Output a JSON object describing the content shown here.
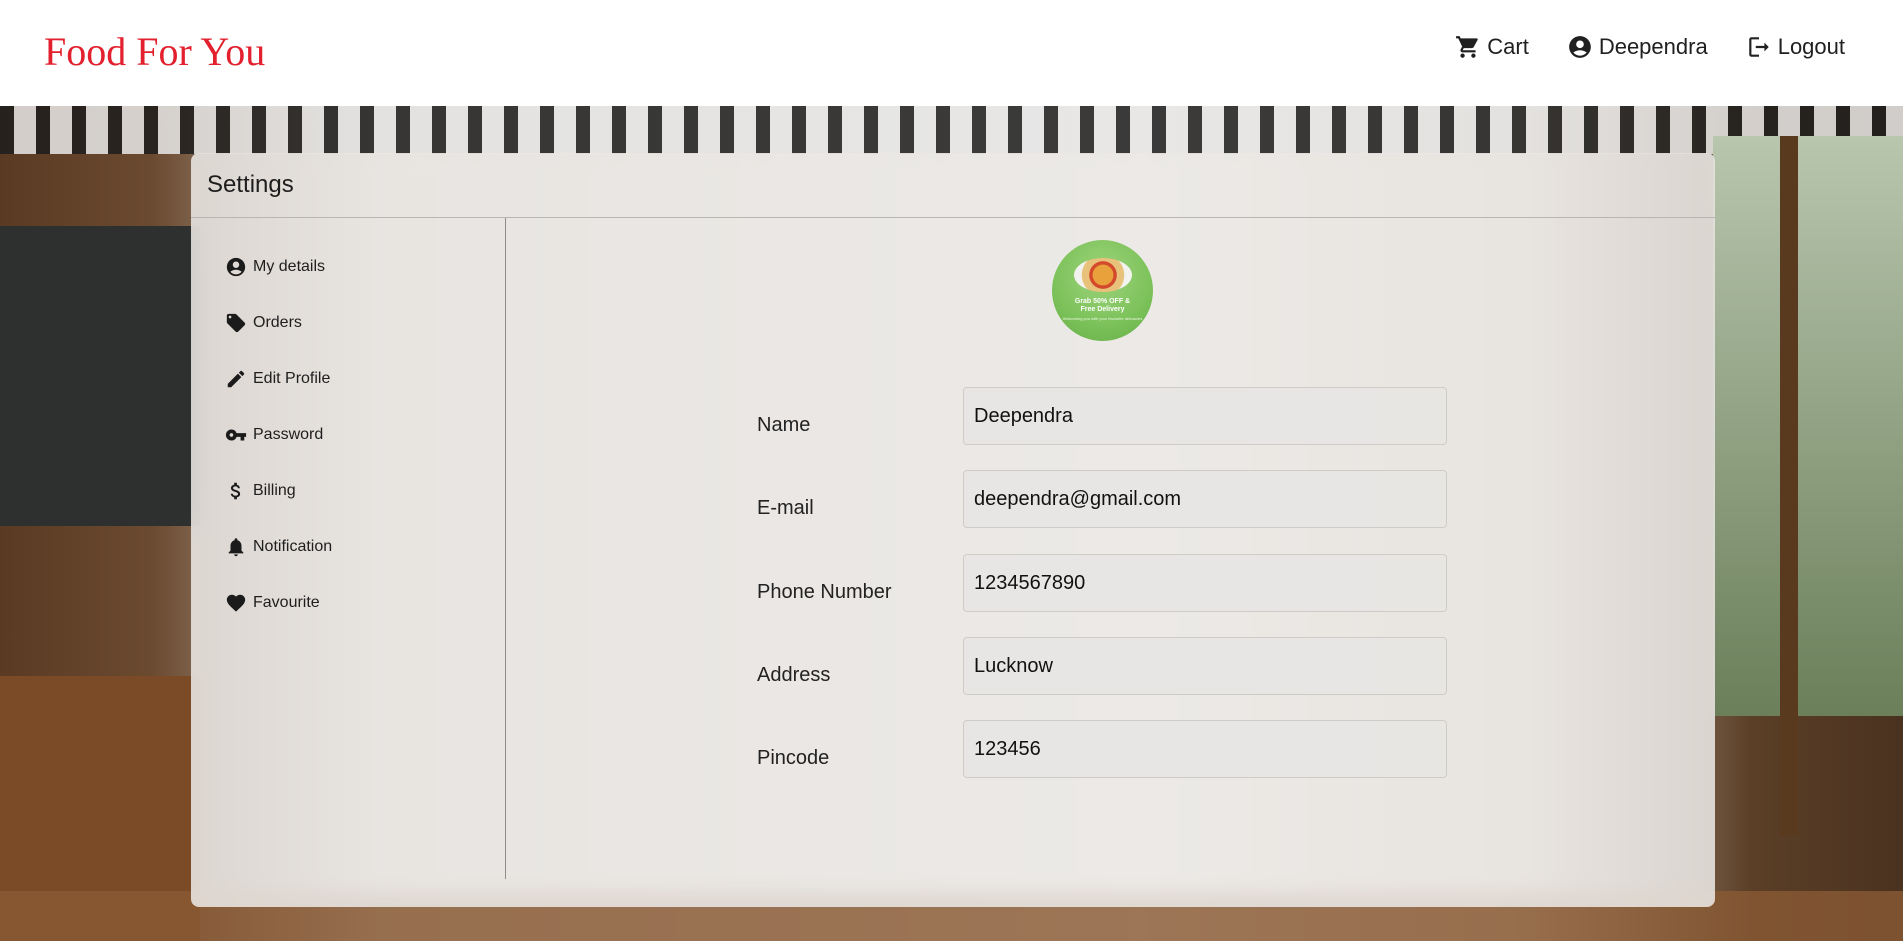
{
  "header": {
    "brand": "Food For You",
    "brand_color": "#e2202e",
    "nav": {
      "cart": {
        "label": "Cart",
        "icon": "cart-icon"
      },
      "user": {
        "label": "Deependra",
        "icon": "account-circle-icon"
      },
      "logout": {
        "label": "Logout",
        "icon": "logout-icon"
      }
    }
  },
  "settings": {
    "title": "Settings",
    "menu": [
      {
        "label": "My details",
        "icon": "account-circle-icon"
      },
      {
        "label": "Orders",
        "icon": "tag-icon"
      },
      {
        "label": "Edit Profile",
        "icon": "pencil-icon"
      },
      {
        "label": "Password",
        "icon": "key-icon"
      },
      {
        "label": "Billing",
        "icon": "dollar-icon"
      },
      {
        "label": "Notification",
        "icon": "bell-icon"
      },
      {
        "label": "Favourite",
        "icon": "heart-icon"
      }
    ],
    "avatar": {
      "promo_text": "Grab 50% OFF &\nFree Delivery",
      "promo_subtext": "Welcoming you with your favourite delicacies"
    },
    "form": {
      "name": {
        "label": "Name",
        "value": "Deependra"
      },
      "email": {
        "label": "E-mail",
        "value": "deependra@gmail.com"
      },
      "phone": {
        "label": "Phone Number",
        "value": "1234567890"
      },
      "address": {
        "label": "Address",
        "value": "Lucknow"
      },
      "pincode": {
        "label": "Pincode",
        "value": "123456"
      }
    }
  }
}
